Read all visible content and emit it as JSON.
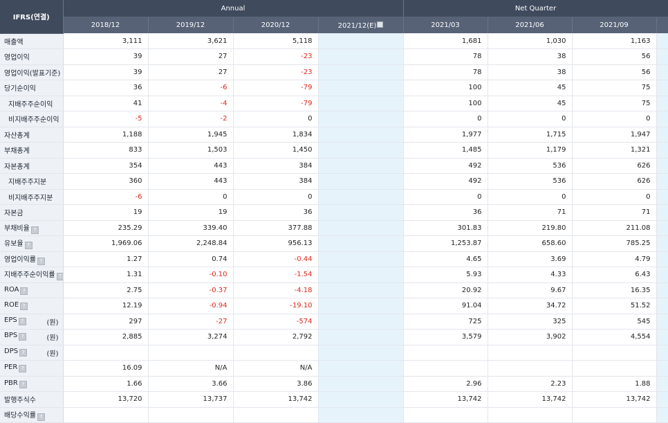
{
  "table": {
    "corner_label": "IFRS(연결)",
    "group_annual": "Annual",
    "group_quarter": "Net Quarter",
    "periods": [
      "2018/12",
      "2019/12",
      "2020/12",
      "2021/12(E)",
      "2021/03",
      "2021/06",
      "2021/09"
    ],
    "estimate_column_index": 3,
    "rows": [
      {
        "label": "매출액",
        "sub": false,
        "values": [
          "3,111",
          "3,621",
          "5,118",
          "",
          "1,681",
          "1,030",
          "1,163"
        ]
      },
      {
        "label": "영업이익",
        "sub": false,
        "values": [
          "39",
          "27",
          "-23",
          "",
          "78",
          "38",
          "56"
        ]
      },
      {
        "label": "영업이익(발표기준)",
        "sub": false,
        "values": [
          "39",
          "27",
          "-23",
          "",
          "78",
          "38",
          "56"
        ]
      },
      {
        "label": "당기순이익",
        "sub": false,
        "values": [
          "36",
          "-6",
          "-79",
          "",
          "100",
          "45",
          "75"
        ]
      },
      {
        "label": "지배주주순이익",
        "sub": true,
        "values": [
          "41",
          "-4",
          "-79",
          "",
          "100",
          "45",
          "75"
        ]
      },
      {
        "label": "비지배주주순이익",
        "sub": true,
        "values": [
          "-5",
          "-2",
          "0",
          "",
          "0",
          "0",
          "0"
        ]
      },
      {
        "label": "자산총계",
        "sub": false,
        "values": [
          "1,188",
          "1,945",
          "1,834",
          "",
          "1,977",
          "1,715",
          "1,947"
        ]
      },
      {
        "label": "부채총계",
        "sub": false,
        "values": [
          "833",
          "1,503",
          "1,450",
          "",
          "1,485",
          "1,179",
          "1,321"
        ]
      },
      {
        "label": "자본총계",
        "sub": false,
        "values": [
          "354",
          "443",
          "384",
          "",
          "492",
          "536",
          "626"
        ]
      },
      {
        "label": "지배주주지분",
        "sub": true,
        "values": [
          "360",
          "443",
          "384",
          "",
          "492",
          "536",
          "626"
        ]
      },
      {
        "label": "비지배주주지분",
        "sub": true,
        "values": [
          "-6",
          "0",
          "0",
          "",
          "0",
          "0",
          "0"
        ]
      },
      {
        "label": "자본금",
        "sub": false,
        "values": [
          "19",
          "19",
          "36",
          "",
          "36",
          "71",
          "71"
        ]
      },
      {
        "label": "부채비율",
        "help": true,
        "sub": false,
        "values": [
          "235.29",
          "339.40",
          "377.88",
          "",
          "301.83",
          "219.80",
          "211.08"
        ]
      },
      {
        "label": "유보율",
        "help": true,
        "sub": false,
        "values": [
          "1,969.06",
          "2,248.84",
          "956.13",
          "",
          "1,253.87",
          "658.60",
          "785.25"
        ]
      },
      {
        "label": "영업이익률",
        "help": true,
        "sub": false,
        "values": [
          "1.27",
          "0.74",
          "-0.44",
          "",
          "4.65",
          "3.69",
          "4.79"
        ]
      },
      {
        "label": "지배주주순이익률",
        "help": true,
        "sub": false,
        "values": [
          "1.31",
          "-0.10",
          "-1.54",
          "",
          "5.93",
          "4.33",
          "6.43"
        ]
      },
      {
        "label": "ROA",
        "help": true,
        "sub": false,
        "values": [
          "2.75",
          "-0.37",
          "-4.18",
          "",
          "20.92",
          "9.67",
          "16.35"
        ]
      },
      {
        "label": "ROE",
        "help": true,
        "sub": false,
        "values": [
          "12.19",
          "-0.94",
          "-19.10",
          "",
          "91.04",
          "34.72",
          "51.52"
        ]
      },
      {
        "label": "EPS",
        "help": true,
        "unit": "(원)",
        "sub": false,
        "values": [
          "297",
          "-27",
          "-574",
          "",
          "725",
          "325",
          "545"
        ]
      },
      {
        "label": "BPS",
        "help": true,
        "unit": "(원)",
        "sub": false,
        "values": [
          "2,885",
          "3,274",
          "2,792",
          "",
          "3,579",
          "3,902",
          "4,554"
        ]
      },
      {
        "label": "DPS",
        "help": true,
        "unit": "(원)",
        "sub": false,
        "values": [
          "",
          "",
          "",
          "",
          "",
          "",
          ""
        ]
      },
      {
        "label": "PER",
        "help": true,
        "sub": false,
        "values": [
          "16.09",
          "N/A",
          "N/A",
          "",
          "",
          "",
          ""
        ]
      },
      {
        "label": "PBR",
        "help": true,
        "sub": false,
        "values": [
          "1.66",
          "3.66",
          "3.86",
          "",
          "2.96",
          "2.23",
          "1.88"
        ]
      },
      {
        "label": "발행주식수",
        "sub": false,
        "values": [
          "13,720",
          "13,737",
          "13,742",
          "",
          "13,742",
          "13,742",
          "13,742"
        ]
      },
      {
        "label": "배당수익률",
        "help": true,
        "sub": false,
        "values": [
          "",
          "",
          "",
          "",
          "",
          "",
          ""
        ]
      }
    ]
  },
  "colors": {
    "header_dark": "#3f4a5c",
    "header_mid": "#576277",
    "label_bg": "#eef2f7",
    "estimate_bg": "#e7f3fb",
    "negative": "#e0261c"
  },
  "icons": {
    "help": "info-icon",
    "estimate": "estimate-info-icon"
  }
}
